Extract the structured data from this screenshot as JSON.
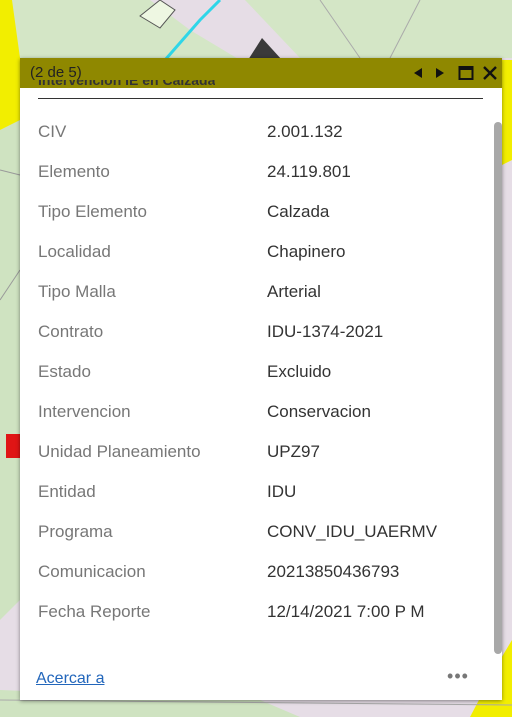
{
  "colors": {
    "header_bg": "#8f8800",
    "map_yellow": "#f2ee00",
    "map_green": "#cfe3c1",
    "map_lavender": "#e6dde6",
    "map_cyan": "#2fd6e8",
    "link": "#2266bb"
  },
  "popup": {
    "pager": "(2 de 5)",
    "prev_icon": "triangle-left-icon",
    "next_icon": "triangle-right-icon",
    "maximize_icon": "maximize-icon",
    "close_icon": "close-icon",
    "title_partial": "Intervencion IE en Calzada",
    "attributes": [
      {
        "label": "CIV",
        "value": "2.001.132"
      },
      {
        "label": "Elemento",
        "value": "24.119.801"
      },
      {
        "label": "Tipo Elemento",
        "value": "Calzada"
      },
      {
        "label": "Localidad",
        "value": "Chapinero"
      },
      {
        "label": "Tipo Malla",
        "value": "Arterial"
      },
      {
        "label": "Contrato",
        "value": "IDU-1374-2021"
      },
      {
        "label": "Estado",
        "value": "Excluido"
      },
      {
        "label": "Intervencion",
        "value": "Conservacion"
      },
      {
        "label": "Unidad Planeamiento",
        "value": "UPZ97"
      },
      {
        "label": "Entidad",
        "value": "IDU"
      },
      {
        "label": "Programa",
        "value": "CONV_IDU_UAERMV"
      },
      {
        "label": "Comunicacion",
        "value": "20213850436793"
      },
      {
        "label": "Fecha Reporte",
        "value": "12/14/2021 7:00 P M"
      }
    ],
    "zoom_link": "Acercar a",
    "more_label": "•••"
  }
}
